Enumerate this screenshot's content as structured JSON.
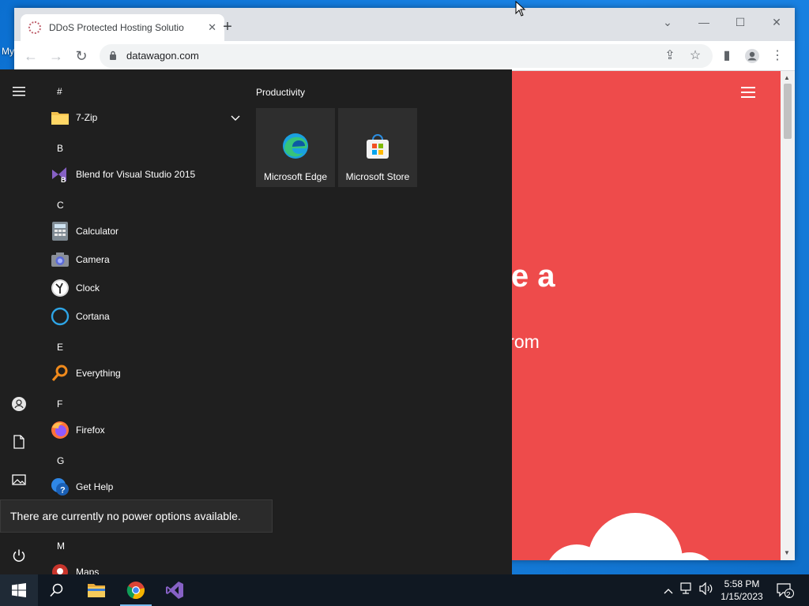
{
  "desktop": {
    "label": "My"
  },
  "browser": {
    "tab": {
      "title": "DDoS Protected Hosting Solutio"
    },
    "omnibox": {
      "url": "datawagon.com"
    },
    "page": {
      "hero_title": "have a",
      "hero_sub": "erver from"
    },
    "colors": {
      "page_bg": "#ee4b4b"
    }
  },
  "start_menu": {
    "sections": [
      {
        "header": "#",
        "apps": [
          {
            "label": "7-Zip",
            "icon": "folder-icon",
            "expandable": true
          }
        ]
      },
      {
        "header": "B",
        "apps": [
          {
            "label": "Blend for Visual Studio 2015",
            "icon": "blend-icon"
          }
        ]
      },
      {
        "header": "C",
        "apps": [
          {
            "label": "Calculator",
            "icon": "calculator-icon"
          },
          {
            "label": "Camera",
            "icon": "camera-icon"
          },
          {
            "label": "Clock",
            "icon": "clock-icon"
          },
          {
            "label": "Cortana",
            "icon": "cortana-icon"
          }
        ]
      },
      {
        "header": "E",
        "apps": [
          {
            "label": "Everything",
            "icon": "magnifier-icon"
          }
        ]
      },
      {
        "header": "F",
        "apps": [
          {
            "label": "Firefox",
            "icon": "firefox-icon"
          }
        ]
      },
      {
        "header": "G",
        "apps": [
          {
            "label": "Get Help",
            "icon": "help-icon"
          }
        ]
      },
      {
        "header": "M",
        "apps": [
          {
            "label": "Maps",
            "icon": "maps-icon"
          }
        ]
      }
    ],
    "group": {
      "title": "Productivity"
    },
    "tiles": [
      {
        "label": "Microsoft Edge",
        "icon": "edge-icon"
      },
      {
        "label": "Microsoft Store",
        "icon": "store-icon"
      }
    ],
    "tooltip": "There are currently no power options available."
  },
  "taskbar": {
    "clock": {
      "time": "5:58 PM",
      "date": "1/15/2023"
    },
    "notification_count": "2"
  }
}
